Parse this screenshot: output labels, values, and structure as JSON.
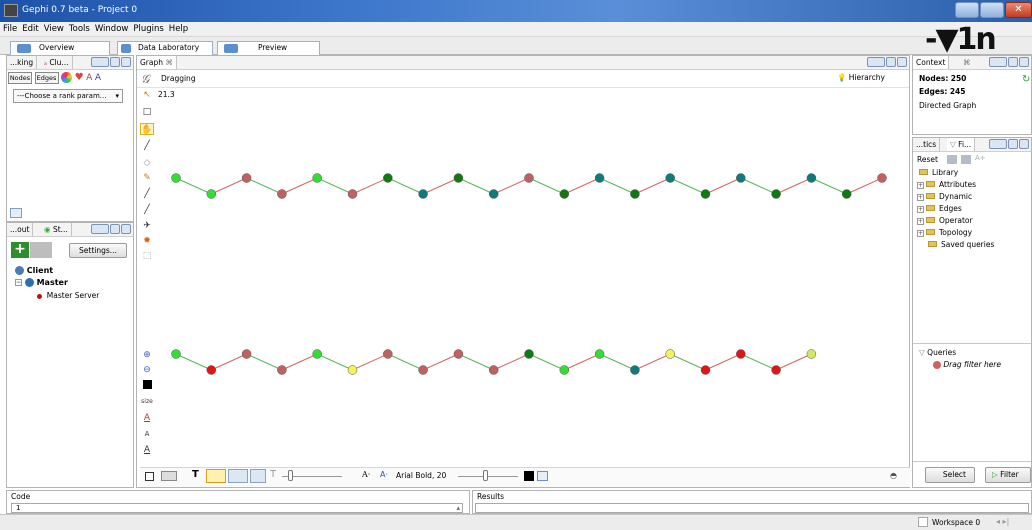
{
  "window": {
    "title": "Gephi 0.7 beta - Project 0"
  },
  "menu": [
    "File",
    "Edit",
    "View",
    "Tools",
    "Window",
    "Plugins",
    "Help"
  ],
  "workspace_tabs": [
    "Overview",
    "Data Laboratory",
    "Preview"
  ],
  "ranking": {
    "tab1": "...king",
    "tab2": "Clu...",
    "nodes_tab": "Nodes",
    "edges_tab": "Edges",
    "rank_select": "---Choose a rank param..."
  },
  "layout": {
    "tab1": "...out",
    "tab2": "St...",
    "settings": "Settings...",
    "tree": {
      "client": "Client",
      "master": "Master",
      "server": "Master Server"
    }
  },
  "graph": {
    "tab": "Graph",
    "mode": "Dragging",
    "hierarchy": "Hierarchy",
    "value": "21.3",
    "font_label": "Arial Bold, 20",
    "size_label": "size"
  },
  "context": {
    "tab": "Context",
    "nodes_label": "Nodes:",
    "nodes_value": "250",
    "edges_label": "Edges:",
    "edges_value": "245",
    "type": "Directed Graph"
  },
  "filters": {
    "tab1": "...tics",
    "tab2": "Fi...",
    "reset": "Reset",
    "library": "Library",
    "items": [
      "Attributes",
      "Dynamic",
      "Edges",
      "Operator",
      "Topology"
    ],
    "saved": "Saved queries",
    "queries": "Queries",
    "drag": "Drag filter here",
    "select": "Select",
    "filter": "Filter"
  },
  "bottom": {
    "code": "Code",
    "code_line": "1",
    "results": "Results",
    "workspace": "Workspace 0"
  },
  "chain1": [
    "#33dd33",
    "#33dd33",
    "#c06060",
    "#c06060",
    "#33dd33",
    "#c06060",
    "#0e7a10",
    "#0f7a7a",
    "#0e7a10",
    "#0f7a7a",
    "#c06060",
    "#0e7a10",
    "#0f7a7a",
    "#0e7a10",
    "#0f7a7a",
    "#0e7a10",
    "#0f7a7a",
    "#0e7a10",
    "#0f7a7a",
    "#0e7a10",
    "#c06060"
  ],
  "chain2": [
    "#33dd33",
    "#e01515",
    "#c06060",
    "#c06060",
    "#33dd33",
    "#f2f25a",
    "#c06060",
    "#c06060",
    "#c06060",
    "#c06060",
    "#0e7a10",
    "#33dd33",
    "#33dd33",
    "#0f7a7a",
    "#f2f25a",
    "#e01515",
    "#e01515",
    "#e01515",
    "#d3e860"
  ],
  "edge_colors": {
    "green": "#59b659",
    "red": "#d06666"
  }
}
